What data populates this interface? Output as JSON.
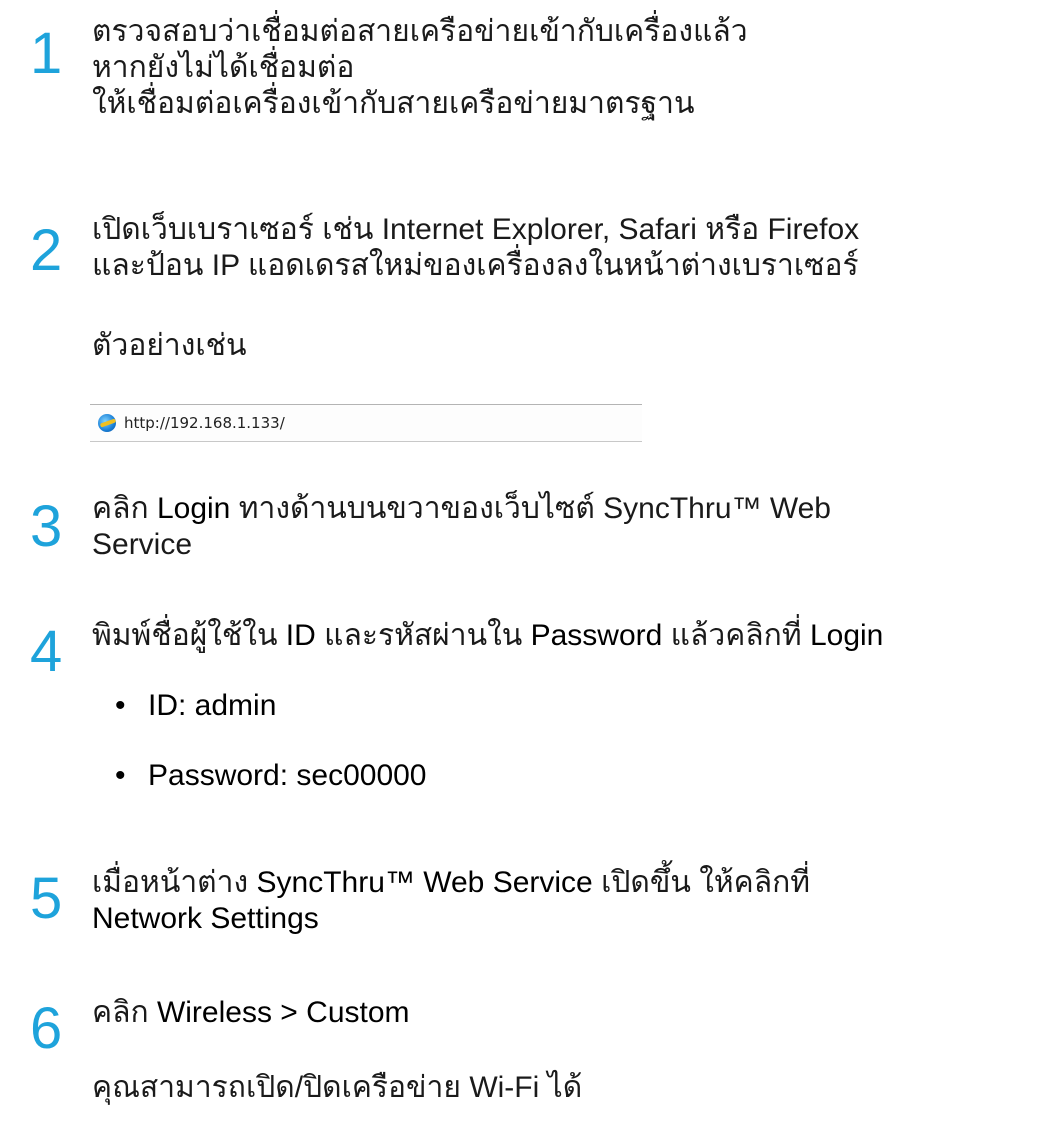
{
  "steps": [
    {
      "number": "1",
      "lines": [
        "ตรวจสอบว่าเชื่อมต่อสายเครือข่ายเข้ากับเครื่องแล้ว",
        "หากยังไม่ได้เชื่อมต่อ",
        "ให้เชื่อมต่อเครื่องเข้ากับสายเครือข่ายมาตรฐาน"
      ]
    },
    {
      "number": "2",
      "lines": [
        "เปิดเว็บเบราเซอร์ เช่น Internet Explorer, Safari หรือ Firefox",
        "และป้อน IP แอดเดรสใหม่ของเครื่องลงในหน้าต่างเบราเซอร์"
      ],
      "example_label": "ตัวอย่างเช่น"
    },
    {
      "number": "3",
      "prefix": "คลิก ",
      "bold": "Login",
      "suffix": " ทางด้านบนขวาของเว็บไซต์ SyncThru™ Web",
      "line2": "Service"
    },
    {
      "number": "4",
      "p1": "พิมพ์ชื่อผู้ใช้ใน ",
      "b1": "ID",
      "p2": " และรหัสผ่านใน ",
      "b2": "Password",
      "p3": " แล้วคลิกที่ ",
      "b3": "Login",
      "bullets": [
        "ID: admin",
        "Password: sec00000"
      ],
      "bullet_char": "•"
    },
    {
      "number": "5",
      "p1": "เมื่อหน้าต่าง ",
      "b1": "SyncThru™ Web Service",
      "p2": " เปิดขึ้น ให้คลิกที่",
      "b2": "Network Settings"
    },
    {
      "number": "6",
      "prefix": "คลิก ",
      "bold": "Wireless > Custom",
      "note": "คุณสามารถเปิด/ปิดเครือข่าย Wi-Fi ได้"
    }
  ],
  "browser_example": {
    "url": "http://192.168.1.133/",
    "icon": "ie-icon"
  },
  "colors": {
    "step_number": "#1ea3db"
  }
}
